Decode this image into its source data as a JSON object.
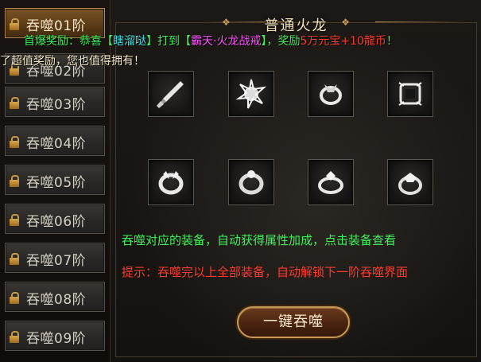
{
  "tiers": [
    {
      "label": "吞噬01阶",
      "active": true
    },
    {
      "label": "吞噬02阶",
      "active": false
    },
    {
      "label": "吞噬03阶",
      "active": false
    },
    {
      "label": "吞噬04阶",
      "active": false
    },
    {
      "label": "吞噬05阶",
      "active": false
    },
    {
      "label": "吞噬06阶",
      "active": false
    },
    {
      "label": "吞噬07阶",
      "active": false
    },
    {
      "label": "吞噬08阶",
      "active": false
    },
    {
      "label": "吞噬09阶",
      "active": false
    }
  ],
  "panel": {
    "title": "普通火龙",
    "info_line": "吞噬对应的装备，自动获得属性加成，点击装备查看",
    "hint_line": "提示：吞噬完以上全部装备，自动解锁下一阶吞噬界面",
    "button_label": "一键吞噬"
  },
  "slots": [
    {
      "icon": "sword-icon"
    },
    {
      "icon": "necklace-icon"
    },
    {
      "icon": "bracelet-icon"
    },
    {
      "icon": "helmet-icon"
    },
    {
      "icon": "bracelet-icon"
    },
    {
      "icon": "bracelet-icon"
    },
    {
      "icon": "ring-icon"
    },
    {
      "icon": "ring-icon"
    }
  ],
  "broadcast": {
    "prefix": "首爆奖励：恭喜【",
    "player": "瞎溜哒",
    "mid": "】打到【",
    "item": "霸天·火龙战戒",
    "mid2": "】，奖励",
    "reward1": "5万元宝",
    "plus": "+",
    "reward2": "10龍币",
    "end": "！",
    "line2": "了超值奖励，您也值得拥有！"
  },
  "colors": {
    "accent_gold": "#c89a54",
    "info_green": "#3ff05a",
    "hint_red": "#ff3a2e"
  }
}
